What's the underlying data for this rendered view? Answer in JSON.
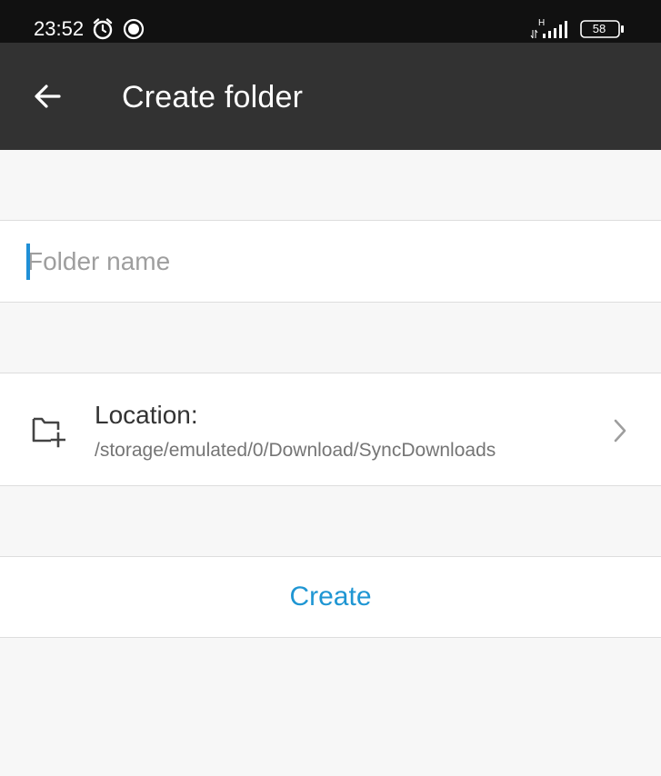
{
  "status_bar": {
    "time": "23:52",
    "network_label": "H",
    "battery_level": "58"
  },
  "app_bar": {
    "title": "Create folder"
  },
  "folder_name": {
    "value": "",
    "placeholder": "Folder name"
  },
  "location": {
    "label": "Location:",
    "path": "/storage/emulated/0/Download/SyncDownloads"
  },
  "create_button": {
    "label": "Create"
  },
  "colors": {
    "status_bar_bg": "#111111",
    "app_bar_bg": "#323232",
    "accent": "#1f96d3",
    "page_bg": "#f7f7f7"
  }
}
